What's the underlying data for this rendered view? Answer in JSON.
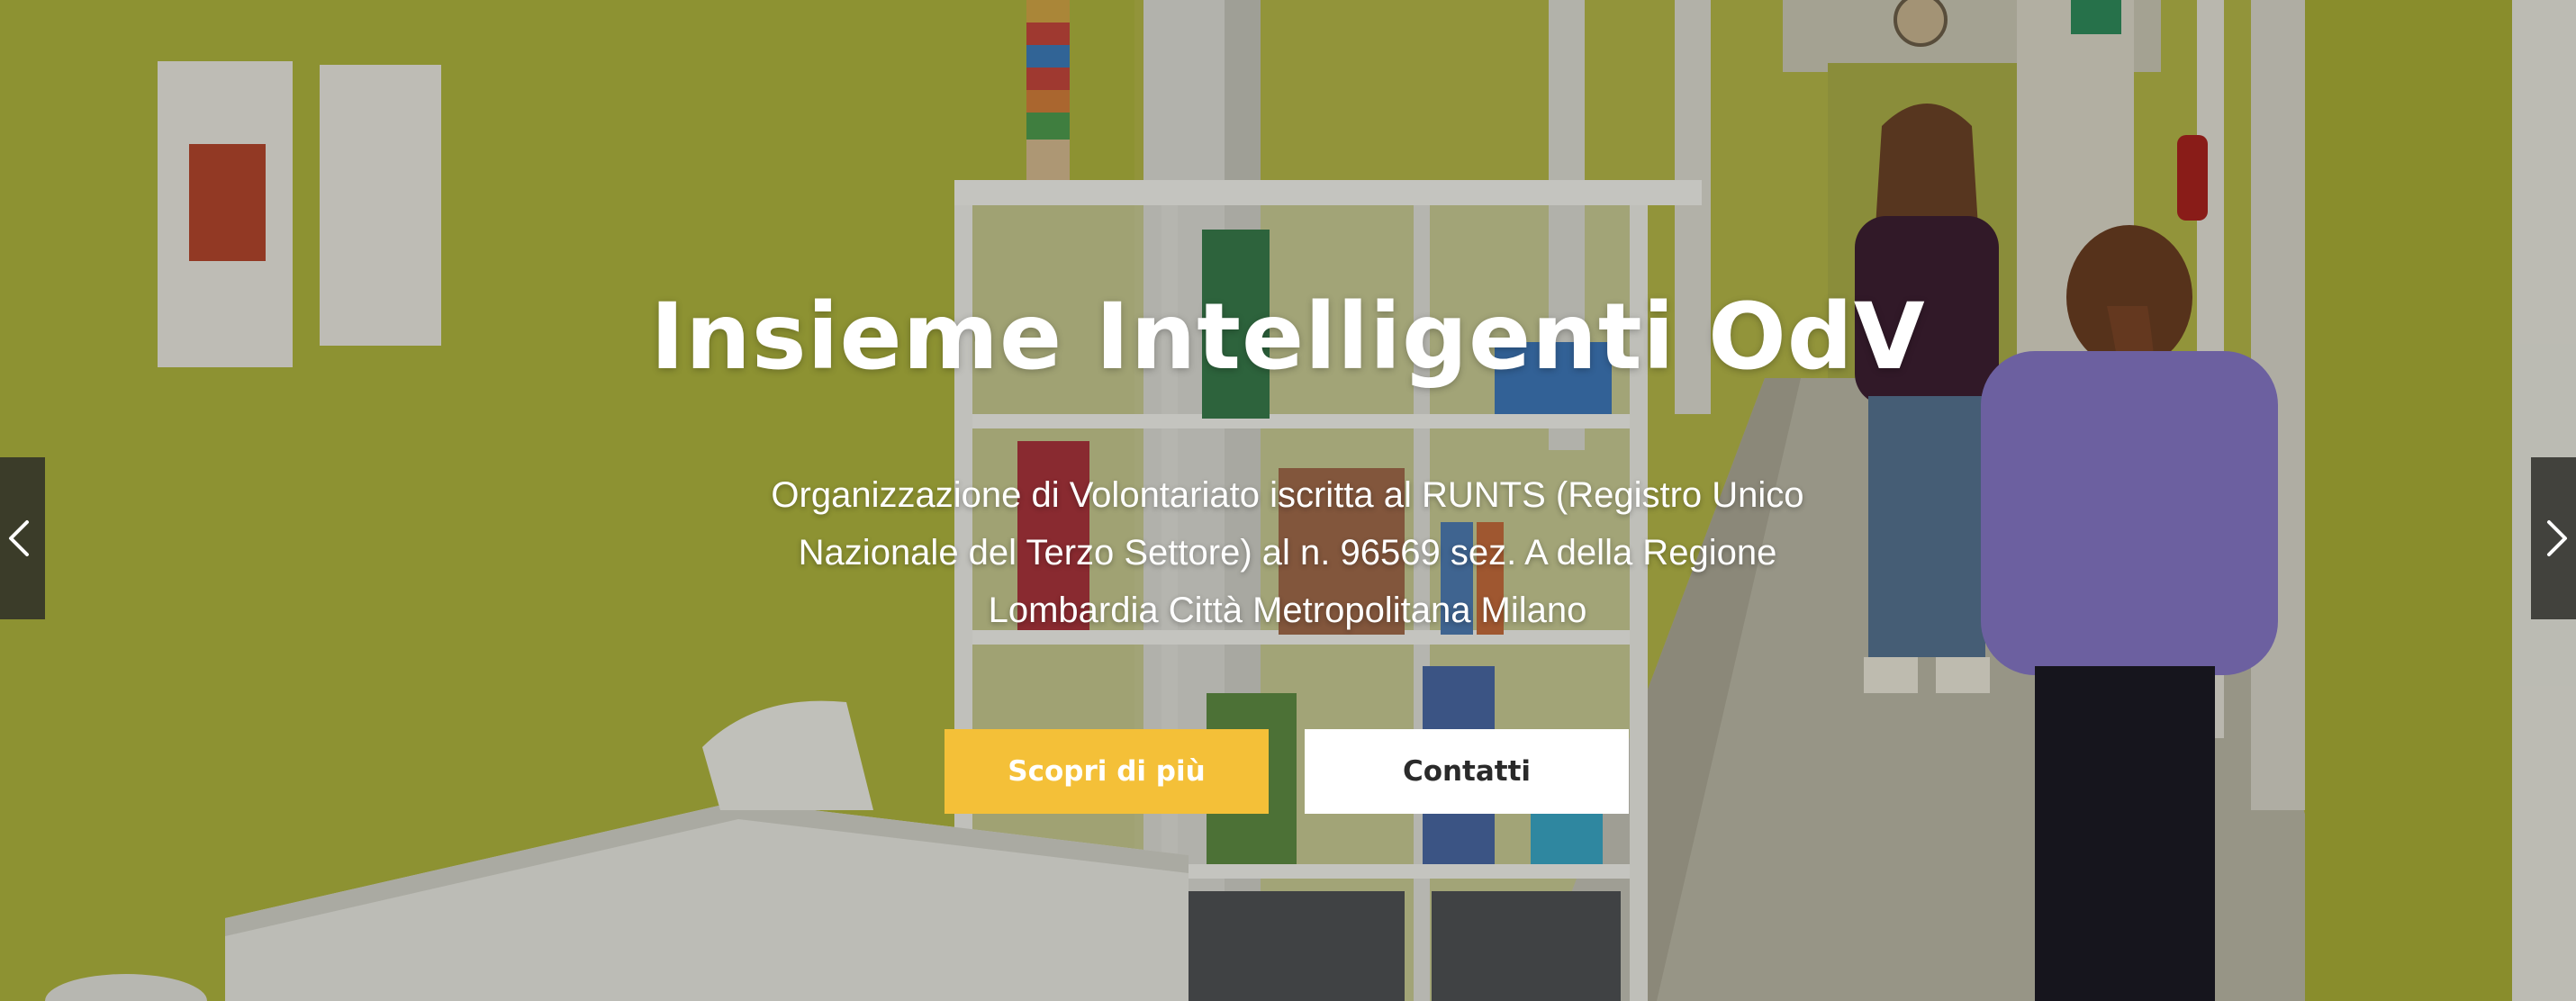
{
  "hero": {
    "title": "Insieme Intelligenti OdV",
    "subtitle": "Organizzazione di Volontariato iscritta al RUNTS (Registro Unico Nazionale del Terzo Settore) al n. 96569 sez. A della Regione Lombardia Città Metropolitana Milano",
    "primary_button": "Scopri di più",
    "secondary_button": "Contatti"
  },
  "slider": {
    "prev_icon": "chevron-left-icon",
    "next_icon": "chevron-right-icon"
  },
  "colors": {
    "accent": "#f4c038",
    "wall": "#a7ab3a",
    "button_secondary_bg": "#ffffff",
    "button_secondary_text": "#2a2a2a"
  }
}
